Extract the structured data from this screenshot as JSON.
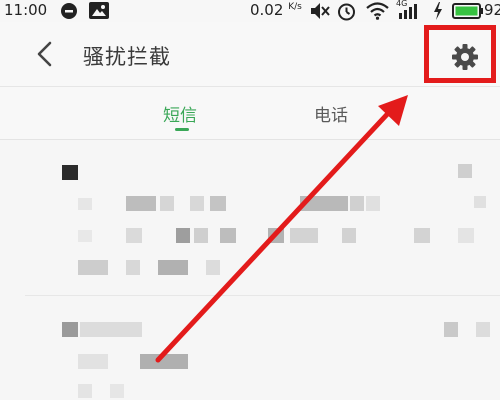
{
  "status_bar": {
    "time": "11:00",
    "network_speed": "0.02",
    "network_speed_unit": "K/s",
    "signal_type": "4G",
    "battery_level": "92",
    "icons": [
      "notification-circle-icon",
      "image-icon",
      "mute-icon",
      "alarm-icon",
      "wifi-icon",
      "signal-bars-icon",
      "charging-icon",
      "battery-icon"
    ]
  },
  "header": {
    "title": "骚扰拦截",
    "back_icon": "chevron-left-icon",
    "settings_icon": "gear-icon"
  },
  "tabs": [
    {
      "label": "短信",
      "active": true
    },
    {
      "label": "电话",
      "active": false
    }
  ],
  "colors": {
    "accent": "#3aa757",
    "annotation_red": "#e31b1b",
    "battery_green": "#37c241"
  }
}
